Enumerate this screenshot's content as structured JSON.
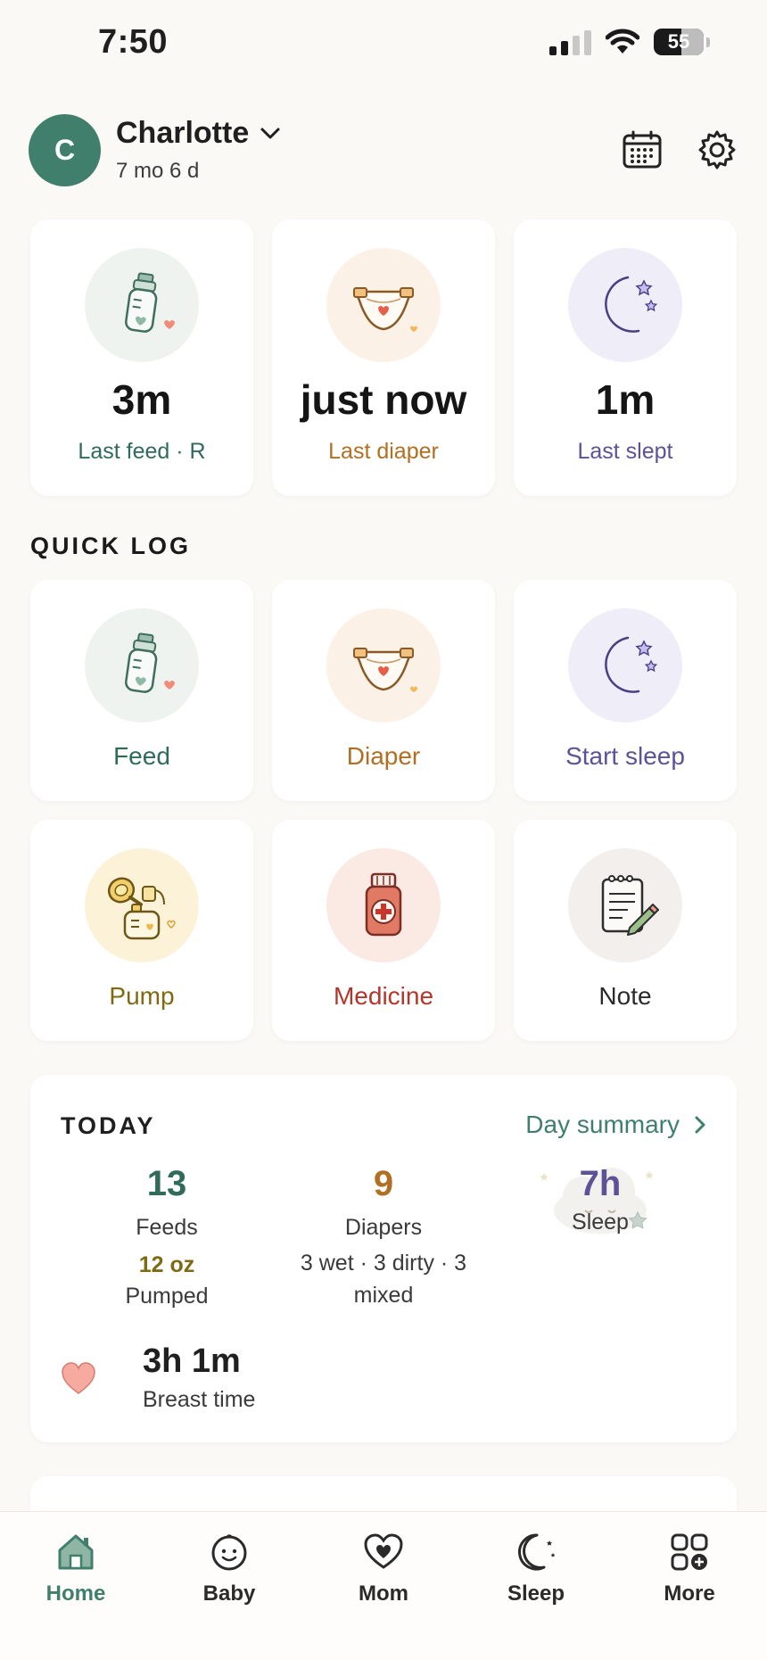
{
  "status_bar": {
    "time": "7:50",
    "battery": "55"
  },
  "header": {
    "avatar_letter": "C",
    "baby_name": "Charlotte",
    "age": "7 mo 6 d"
  },
  "stats": [
    {
      "value": "3m",
      "label": "Last feed · R",
      "icon": "bottle-icon"
    },
    {
      "value": "just now",
      "label": "Last diaper",
      "icon": "diaper-icon"
    },
    {
      "value": "1m",
      "label": "Last slept",
      "icon": "moon-icon"
    }
  ],
  "quick_log": {
    "title": "QUICK LOG",
    "items": [
      {
        "label": "Feed",
        "icon": "bottle-icon"
      },
      {
        "label": "Diaper",
        "icon": "diaper-icon"
      },
      {
        "label": "Start sleep",
        "icon": "moon-icon"
      },
      {
        "label": "Pump",
        "icon": "breast-pump-icon"
      },
      {
        "label": "Medicine",
        "icon": "medicine-bottle-icon"
      },
      {
        "label": "Note",
        "icon": "notepad-icon"
      }
    ]
  },
  "today": {
    "title": "TODAY",
    "summary_link": "Day summary",
    "feeds": {
      "value": "13",
      "label": "Feeds"
    },
    "pumped": {
      "value": "12 oz",
      "label": "Pumped"
    },
    "diapers": {
      "value": "9",
      "label": "Diapers",
      "detail": "3 wet · 3 dirty · 3 mixed"
    },
    "sleep": {
      "value": "7h",
      "label": "Sleep"
    },
    "breast": {
      "value": "3h 1m",
      "label": "Breast time"
    }
  },
  "tabs": [
    {
      "label": "Home",
      "icon": "home-icon"
    },
    {
      "label": "Baby",
      "icon": "baby-face-icon"
    },
    {
      "label": "Mom",
      "icon": "heart-icon"
    },
    {
      "label": "Sleep",
      "icon": "moon-icon"
    },
    {
      "label": "More",
      "icon": "grid-plus-icon"
    }
  ],
  "colors": {
    "accent": "#3f7f6c",
    "feed": "#2f6b58",
    "diaper": "#b06f22",
    "sleep": "#5d5296",
    "pump": "#7f6a14",
    "medicine": "#b3362a",
    "background": "#fbf9f6"
  }
}
